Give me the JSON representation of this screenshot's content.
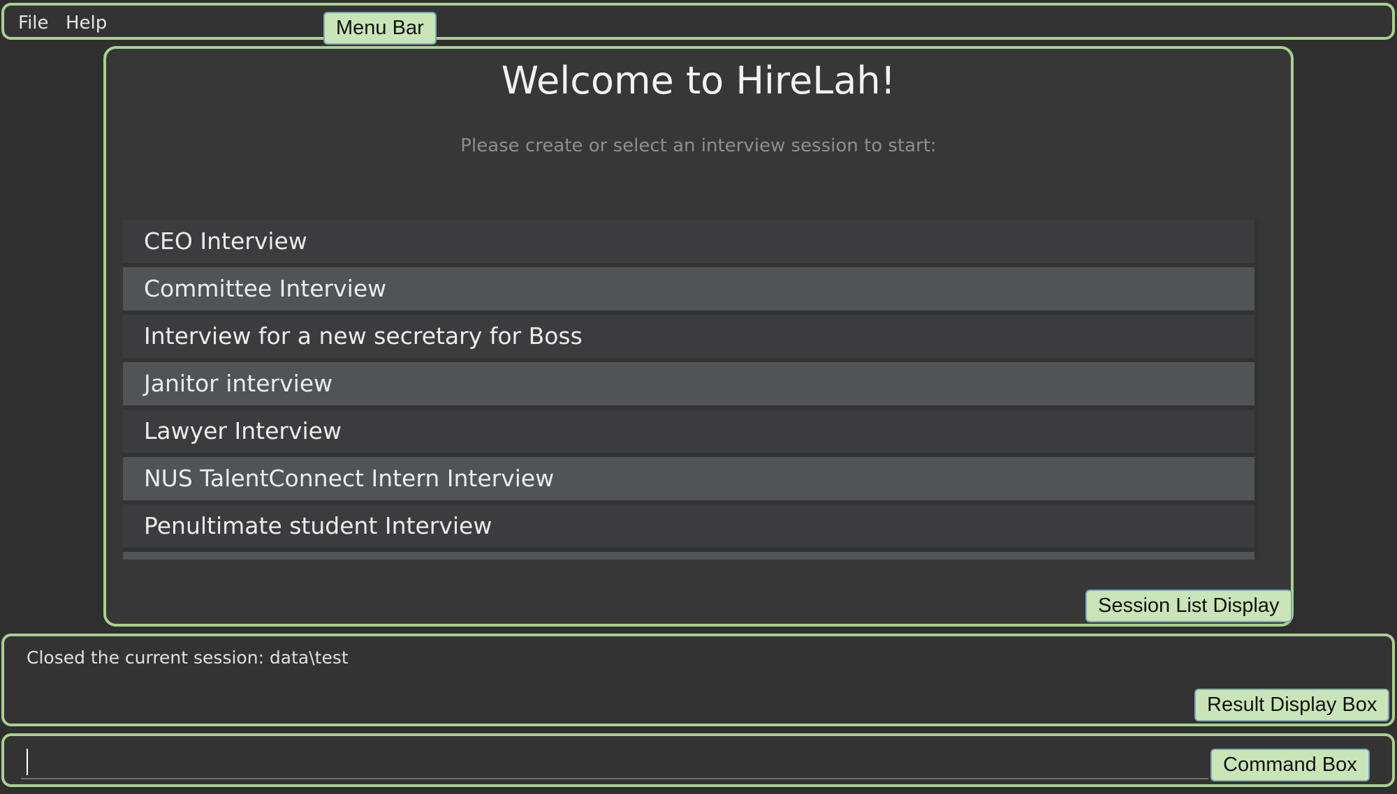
{
  "menu_bar": {
    "items": [
      {
        "label": "File"
      },
      {
        "label": "Help"
      }
    ],
    "annotation": "Menu Bar"
  },
  "session_panel": {
    "title": "Welcome to HireLah!",
    "subtitle": "Please create or select an interview session to start:",
    "sessions": [
      {
        "label": "CEO Interview"
      },
      {
        "label": "Committee Interview"
      },
      {
        "label": "Interview for a new secretary for Boss"
      },
      {
        "label": "Janitor interview"
      },
      {
        "label": "Lawyer Interview"
      },
      {
        "label": "NUS TalentConnect Intern Interview"
      },
      {
        "label": "Penultimate student Interview"
      }
    ],
    "annotation": "Session List Display"
  },
  "result_display": {
    "text": "Closed the current session: data\\test",
    "annotation": "Result Display Box"
  },
  "command_box": {
    "value": "",
    "annotation": "Command Box"
  },
  "colors": {
    "annotation_border": "#a9d18e",
    "annotation_fill": "#c9e5b8",
    "background": "#2f2f2f",
    "row_dark": "#3c3c3e",
    "row_light": "#505456"
  }
}
